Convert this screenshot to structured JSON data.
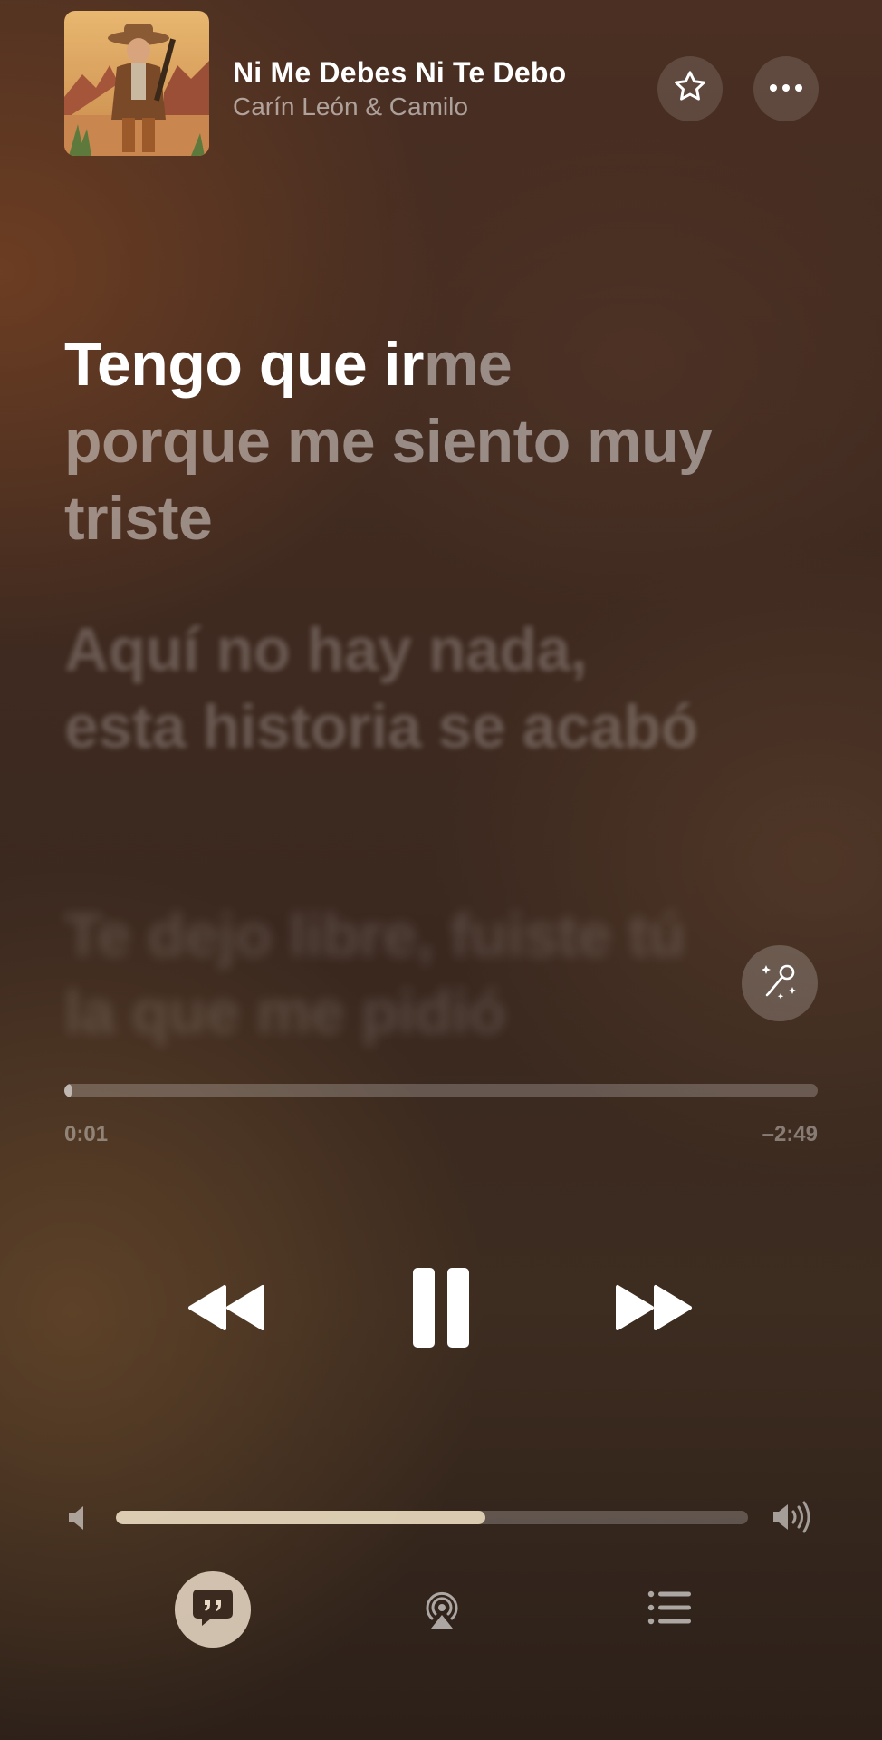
{
  "now_playing": {
    "title": "Ni Me Debes Ni Te Debo",
    "artist": "Carín León & Camilo",
    "artwork_icon": "album-artwork-cowboy-desert"
  },
  "header_actions": {
    "favorite_icon": "star-outline-icon",
    "more_icon": "ellipsis-icon"
  },
  "lyrics": {
    "active": {
      "sung": "Tengo que ir",
      "unsung": "me porque me siento muy triste"
    },
    "next": "Aquí no hay nada, esta historia se acabó",
    "next2": "Te dejo libre, fuiste tú la que me pidió"
  },
  "playback": {
    "elapsed": "0:01",
    "remaining": "–2:49",
    "progress_fraction": 0.007
  },
  "transport": {
    "rewind_icon": "rewind-icon",
    "pause_icon": "pause-icon",
    "forward_icon": "fast-forward-icon"
  },
  "volume": {
    "level_fraction": 0.585
  },
  "bottom_bar": {
    "lyrics_icon": "quote-bubble-icon",
    "airplay_icon": "airplay-audio-icon",
    "queue_icon": "list-icon"
  },
  "colors": {
    "accent_lyrics_button": "#e8d9c4",
    "volume_fill": "#ebdcbe"
  }
}
